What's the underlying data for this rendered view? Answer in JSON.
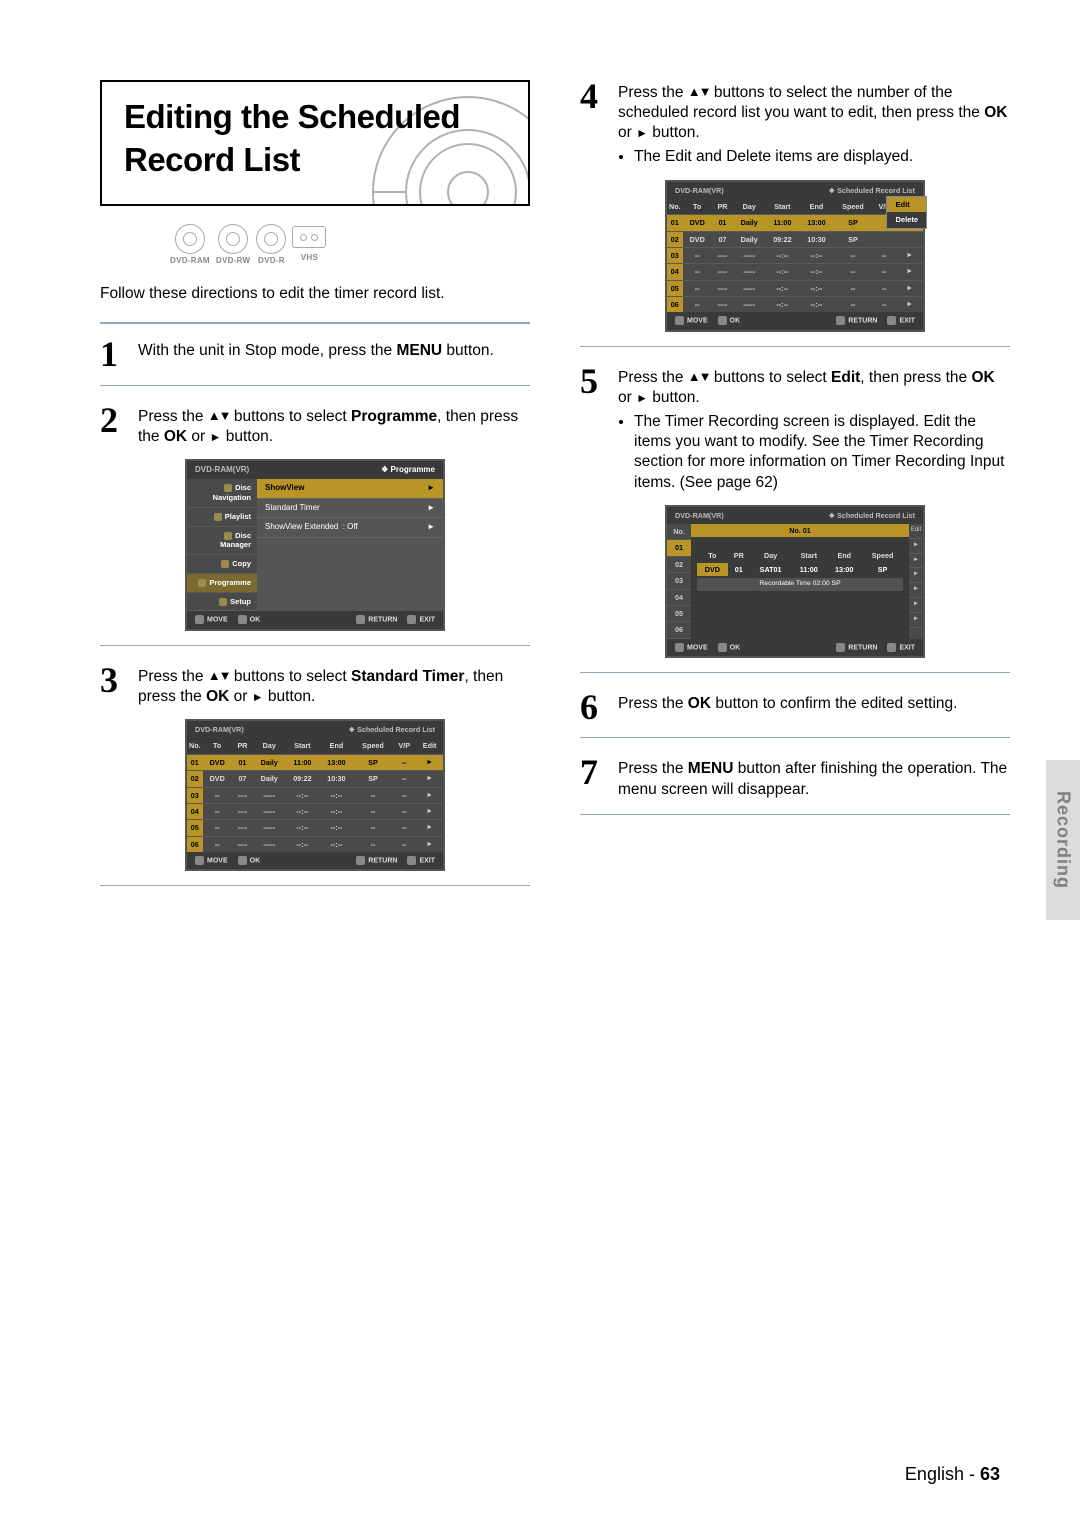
{
  "header": {
    "title": "Editing the Scheduled Record List"
  },
  "media_icons": [
    "DVD-RAM",
    "DVD-RW",
    "DVD-R",
    "VHS"
  ],
  "lead": "Follow these directions to edit the timer record list.",
  "steps": {
    "s1": {
      "num": "1",
      "text_a": "With the unit in Stop mode, press the ",
      "text_b": "MENU",
      "text_c": " button."
    },
    "s2": {
      "num": "2",
      "text_a": "Press the ",
      "arrows": "▲▼",
      "text_b": " buttons to select ",
      "bold": "Programme",
      "text_c": ", then press the ",
      "bold2": "OK",
      "text_d": " or ",
      "play": "►",
      "text_e": " button."
    },
    "s3": {
      "num": "3",
      "text_a": "Press the ",
      "arrows": "▲▼",
      "text_b": " buttons to select ",
      "bold": "Standard Timer",
      "text_c": ", then press the ",
      "bold2": "OK",
      "text_d": " or ",
      "play": "►",
      "text_e": " button."
    },
    "s4": {
      "num": "4",
      "text_a": "Press the ",
      "arrows": "▲▼",
      "text_b": " buttons to select the number of the scheduled record list you want to edit, then press the ",
      "bold": "OK",
      "text_c": " or ",
      "play": "►",
      "text_d": " button.",
      "bullet": "The Edit and Delete items are displayed."
    },
    "s5": {
      "num": "5",
      "text_a": "Press the ",
      "arrows": "▲▼",
      "text_b": " buttons to select ",
      "bold": "Edit",
      "text_c": ", then press the ",
      "bold2": "OK",
      "text_d": " or ",
      "play": "►",
      "text_e": " button.",
      "bullet": "The Timer Recording screen is displayed. Edit the items you want to modify. See the Timer Recording section for more information on Timer Recording Input items. (See page 62)"
    },
    "s6": {
      "num": "6",
      "text_a": "Press the ",
      "bold": "OK",
      "text_b": " button to confirm the edited setting."
    },
    "s7": {
      "num": "7",
      "text_a": "Press the ",
      "bold": "MENU",
      "text_b": " button after finishing the operation. The menu screen will disappear."
    }
  },
  "osd_menu": {
    "device": "DVD-RAM(VR)",
    "title": "Programme",
    "side": [
      "Disc Navigation",
      "Playlist",
      "Disc Manager",
      "Copy",
      "Programme",
      "Setup"
    ],
    "items": [
      {
        "label": "ShowView",
        "sel": true
      },
      {
        "label": "Standard Timer"
      },
      {
        "label": "ShowView Extended",
        "value": ": Off"
      }
    ],
    "foot": [
      "MOVE",
      "OK",
      "RETURN",
      "EXIT"
    ]
  },
  "osd_list": {
    "device": "DVD-RAM(VR)",
    "title": "Scheduled Record List",
    "cols": [
      "No.",
      "To",
      "PR",
      "Day",
      "Start",
      "End",
      "Speed",
      "V/P",
      "Edit"
    ],
    "rows": [
      {
        "no": "01",
        "to": "DVD",
        "pr": "01",
        "day": "Daily",
        "start": "11:00",
        "end": "13:00",
        "speed": "SP",
        "vp": "--",
        "sel": true
      },
      {
        "no": "02",
        "to": "DVD",
        "pr": "07",
        "day": "Daily",
        "start": "09:22",
        "end": "10:30",
        "speed": "SP",
        "vp": "--"
      },
      {
        "no": "03",
        "to": "--",
        "pr": "----",
        "day": "-----",
        "start": "--:--",
        "end": "--:--",
        "speed": "--",
        "vp": "--"
      },
      {
        "no": "04",
        "to": "--",
        "pr": "----",
        "day": "-----",
        "start": "--:--",
        "end": "--:--",
        "speed": "--",
        "vp": "--"
      },
      {
        "no": "05",
        "to": "--",
        "pr": "----",
        "day": "-----",
        "start": "--:--",
        "end": "--:--",
        "speed": "--",
        "vp": "--"
      },
      {
        "no": "06",
        "to": "--",
        "pr": "----",
        "day": "-----",
        "start": "--:--",
        "end": "--:--",
        "speed": "--",
        "vp": "--"
      }
    ],
    "foot": [
      "MOVE",
      "OK",
      "RETURN",
      "EXIT"
    ]
  },
  "osd_list_pop": {
    "device": "DVD-RAM(VR)",
    "title": "Scheduled Record List",
    "popup": [
      "Edit",
      "Delete"
    ],
    "rows": [
      {
        "no": "01",
        "to": "DVD",
        "pr": "01",
        "day": "Daily",
        "start": "11:00",
        "end": "13:00",
        "speed": "SP",
        "sel": true
      },
      {
        "no": "02",
        "to": "DVD",
        "pr": "07",
        "day": "Daily",
        "start": "09:22",
        "end": "10:30",
        "speed": "SP"
      },
      {
        "no": "03",
        "to": "--",
        "pr": "----",
        "day": "-----",
        "start": "--:--",
        "end": "--:--",
        "speed": "--"
      },
      {
        "no": "04",
        "to": "--",
        "pr": "----",
        "day": "-----",
        "start": "--:--",
        "end": "--:--",
        "speed": "--"
      },
      {
        "no": "05",
        "to": "--",
        "pr": "----",
        "day": "-----",
        "start": "--:--",
        "end": "--:--",
        "speed": "--"
      },
      {
        "no": "06",
        "to": "--",
        "pr": "----",
        "day": "-----",
        "start": "--:--",
        "end": "--:--",
        "speed": "--"
      }
    ],
    "foot": [
      "MOVE",
      "OK",
      "RETURN",
      "EXIT"
    ]
  },
  "osd_edit": {
    "device": "DVD-RAM(VR)",
    "title": "Scheduled Record List",
    "banner": "No. 01",
    "left": [
      "No.",
      "01",
      "02",
      "03",
      "04",
      "05",
      "06"
    ],
    "right_edit": "Edit",
    "cols": [
      "To",
      "PR",
      "Day",
      "Start",
      "End",
      "Speed"
    ],
    "row": {
      "to": "DVD",
      "pr": "01",
      "day": "SAT01",
      "start": "11:00",
      "end": "13:00",
      "speed": "SP"
    },
    "rec_time": "Recordable Time 02:00 SP",
    "foot": [
      "MOVE",
      "OK",
      "RETURN",
      "EXIT"
    ]
  },
  "side_tab": "Recording",
  "footer": {
    "lang": "English - ",
    "page": "63"
  }
}
